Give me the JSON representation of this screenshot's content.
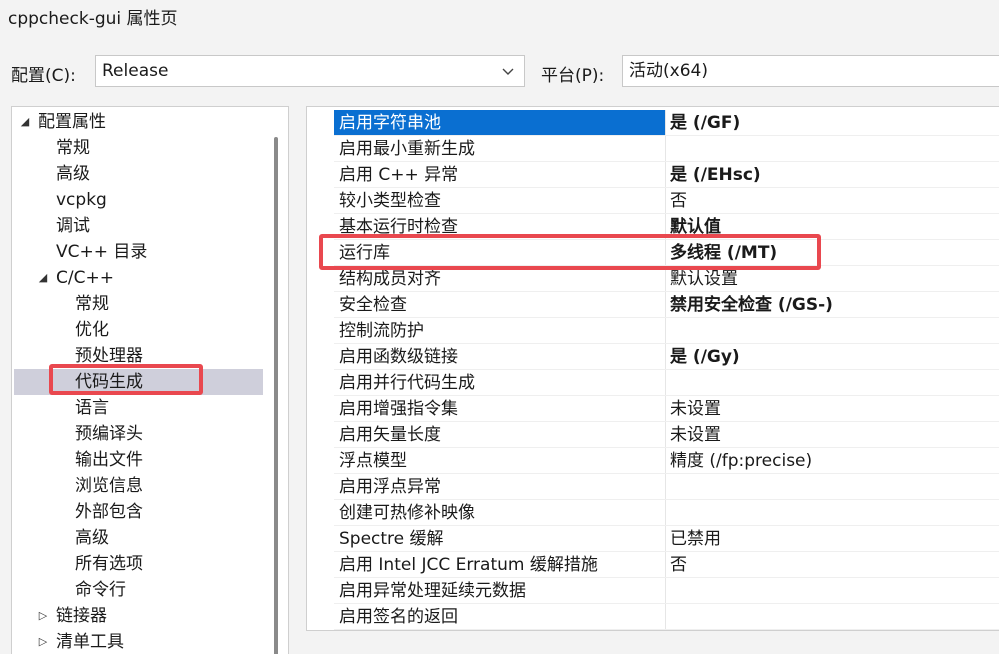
{
  "window": {
    "title": "cppcheck-gui 属性页"
  },
  "config": {
    "label": "配置(C):",
    "value": "Release"
  },
  "platform": {
    "label": "平台(P):",
    "value": "活动(x64)"
  },
  "tree": {
    "items": [
      {
        "label": "配置属性",
        "level": 0,
        "arrow": "▲"
      },
      {
        "label": "常规",
        "level": 1
      },
      {
        "label": "高级",
        "level": 1
      },
      {
        "label": "vcpkg",
        "level": 1
      },
      {
        "label": "调试",
        "level": 1
      },
      {
        "label": "VC++ 目录",
        "level": 1
      },
      {
        "label": "C/C++",
        "level": 1,
        "arrow": "▲"
      },
      {
        "label": "常规",
        "level": 2
      },
      {
        "label": "优化",
        "level": 2
      },
      {
        "label": "预处理器",
        "level": 2
      },
      {
        "label": "代码生成",
        "level": 2,
        "selected": true
      },
      {
        "label": "语言",
        "level": 2
      },
      {
        "label": "预编译头",
        "level": 2
      },
      {
        "label": "输出文件",
        "level": 2
      },
      {
        "label": "浏览信息",
        "level": 2
      },
      {
        "label": "外部包含",
        "level": 2
      },
      {
        "label": "高级",
        "level": 2
      },
      {
        "label": "所有选项",
        "level": 2
      },
      {
        "label": "命令行",
        "level": 2
      },
      {
        "label": "链接器",
        "level": 1,
        "arrow": "▷"
      },
      {
        "label": "清单工具",
        "level": 1,
        "arrow": "▷"
      }
    ]
  },
  "properties": {
    "rows": [
      {
        "name": "启用字符串池",
        "value": "是 (/GF)",
        "bold": true,
        "selected": true
      },
      {
        "name": "启用最小重新生成",
        "value": ""
      },
      {
        "name": "启用 C++ 异常",
        "value": "是 (/EHsc)",
        "bold": true
      },
      {
        "name": "较小类型检查",
        "value": "否"
      },
      {
        "name": "基本运行时检查",
        "value": "默认值",
        "bold": true
      },
      {
        "name": "运行库",
        "value": "多线程 (/MT)",
        "bold": true
      },
      {
        "name": "结构成员对齐",
        "value": "默认设置"
      },
      {
        "name": "安全检查",
        "value": "禁用安全检查 (/GS-)",
        "bold": true
      },
      {
        "name": "控制流防护",
        "value": ""
      },
      {
        "name": "启用函数级链接",
        "value": "是 (/Gy)",
        "bold": true
      },
      {
        "name": "启用并行代码生成",
        "value": ""
      },
      {
        "name": "启用增强指令集",
        "value": "未设置"
      },
      {
        "name": "启用矢量长度",
        "value": "未设置"
      },
      {
        "name": "浮点模型",
        "value": "精度 (/fp:precise)"
      },
      {
        "name": "启用浮点异常",
        "value": ""
      },
      {
        "name": "创建可热修补映像",
        "value": ""
      },
      {
        "name": "Spectre 缓解",
        "value": "已禁用"
      },
      {
        "name": "启用 Intel JCC Erratum 缓解措施",
        "value": "否"
      },
      {
        "name": "启用异常处理延续元数据",
        "value": ""
      },
      {
        "name": "启用签名的返回",
        "value": ""
      }
    ]
  },
  "colors": {
    "selection_blue": "#0a6fd1",
    "highlight_red": "#e9484f",
    "tree_selection": "#cfcfdb"
  }
}
